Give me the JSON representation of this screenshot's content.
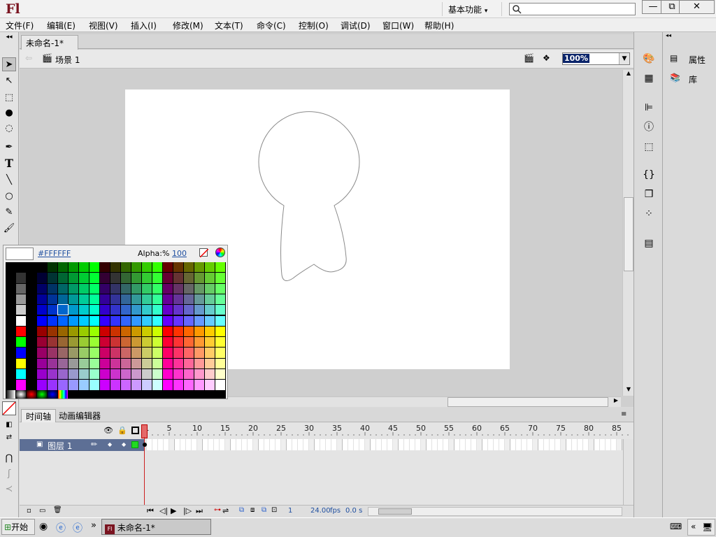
{
  "app": {
    "logo": "Fl",
    "workspace": "基本功能",
    "search_placeholder": ""
  },
  "window_controls": {
    "minimize": "—",
    "restore": "⧉",
    "close": "✕"
  },
  "menubar": {
    "items": [
      "文件(F)",
      "编辑(E)",
      "视图(V)",
      "插入(I)",
      "修改(M)",
      "文本(T)",
      "命令(C)",
      "控制(O)",
      "调试(D)",
      "窗口(W)",
      "帮助(H)"
    ]
  },
  "document": {
    "tab_title": "未命名-1*",
    "tab_close": "×",
    "scene_label": "场景 1",
    "zoom": "100%"
  },
  "swatch_popup": {
    "hex": "#FFFFFF",
    "alpha_label": "Alpha:%",
    "alpha_value": "100"
  },
  "right_panel": {
    "properties_label": "属性",
    "library_label": "库"
  },
  "timeline": {
    "tabs": [
      "时间轴",
      "动画编辑器"
    ],
    "ruler": [
      "1",
      "5",
      "10",
      "15",
      "20",
      "25",
      "30",
      "35",
      "40",
      "45",
      "50",
      "55",
      "60",
      "65",
      "70",
      "75",
      "80",
      "85"
    ],
    "layer_name": "图层 1",
    "current_frame": "1",
    "fps": "24.00",
    "fps_unit": "fps",
    "time": "0.0 s"
  },
  "taskbar": {
    "start_label": "开始",
    "task_label": "未命名-1*",
    "chevron": "»"
  }
}
